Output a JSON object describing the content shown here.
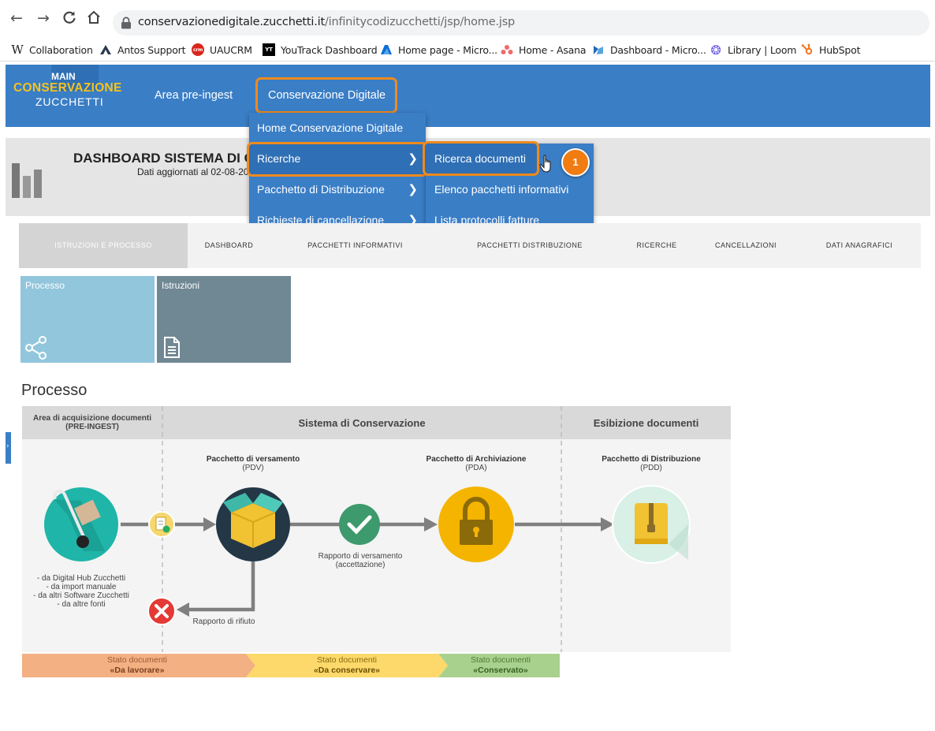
{
  "browser": {
    "url_host": "conservazionedigitale.zucchetti.it",
    "url_path": "/infinitycodizucchetti/jsp/home.jsp",
    "bookmarks": [
      {
        "label": "Collaboration"
      },
      {
        "label": "Antos Support"
      },
      {
        "label": "UAUCRM"
      },
      {
        "label": "YouTrack Dashboard"
      },
      {
        "label": "Home page - Micro..."
      },
      {
        "label": "Home - Asana"
      },
      {
        "label": "Dashboard - Micro..."
      },
      {
        "label": "Library | Loom"
      },
      {
        "label": "HubSpot"
      }
    ]
  },
  "app": {
    "logo_main": "MAIN",
    "logo_conservazione": "CONSERVAZIONE",
    "logo_zucchetti": "ZUCCHETTI",
    "nav": {
      "preingest": "Area pre-ingest",
      "conservazione": "Conservazione Digitale"
    },
    "menu": {
      "items": [
        {
          "label": "Home Conservazione Digitale"
        },
        {
          "label": "Ricerche"
        },
        {
          "label": "Pacchetto di Distribuzione"
        },
        {
          "label": "Richieste di cancellazione"
        }
      ],
      "submenu": [
        {
          "label": "Ricerca documenti"
        },
        {
          "label": "Elenco pacchetti informativi"
        },
        {
          "label": "Lista protocolli fatture"
        }
      ]
    },
    "step_badge": "1",
    "dashboard": {
      "title": "DASHBOARD SISTEMA DI C",
      "date": "Dati aggiornati al 02-08-20"
    },
    "tabs": [
      {
        "label": "ISTRUZIONI E PROCESSO"
      },
      {
        "label": "DASHBOARD"
      },
      {
        "label": "PACCHETTI INFORMATIVI"
      },
      {
        "label": "PACCHETTI DISTRIBUZIONE"
      },
      {
        "label": "RICERCHE"
      },
      {
        "label": "CANCELLAZIONI"
      },
      {
        "label": "DATI ANAGRAFICI"
      }
    ],
    "tiles": {
      "processo": "Processo",
      "istruzioni": "Istruzioni"
    },
    "section_title": "Processo",
    "diagram": {
      "head_preingest_1": "Area di acquisizione documenti",
      "head_preingest_2": "(PRE-INGEST)",
      "head_sistema": "Sistema di Conservazione",
      "head_esibizione": "Esibizione documenti",
      "pdv_title": "Pacchetto di versamento",
      "pdv_sub": "(PDV)",
      "pda_title": "Pacchetto di Archiviazione",
      "pda_sub": "(PDA)",
      "pdd_title": "Pacchetto di Distribuzione",
      "pdd_sub": "(PDD)",
      "sources": [
        "- da Digital Hub Zucchetti",
        "- da import manuale",
        "- da altri Software Zucchetti",
        "- da altre fonti"
      ],
      "rapporto_1": "Rapporto di versamento",
      "rapporto_2": "(accettazione)",
      "rifiuto": "Rapporto di rifiuto"
    },
    "status": [
      {
        "line1": "Stato documenti",
        "line2": "«Da lavorare»",
        "color": "#f3b083"
      },
      {
        "line1": "Stato documenti",
        "line2": "«Da conservare»",
        "color": "#fcd96a"
      },
      {
        "line1": "Stato documenti",
        "line2": "«Conservato»",
        "color": "#a9d18e"
      }
    ]
  }
}
